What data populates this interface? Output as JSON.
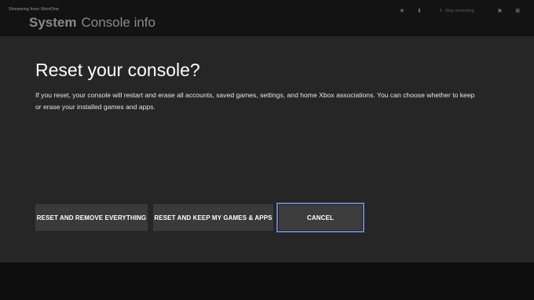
{
  "stream": {
    "label": "Streaming from XboxOne"
  },
  "header": {
    "section": "System",
    "page": "Console info"
  },
  "status": {
    "icons": [
      "headset-icon",
      "mic-icon",
      "controller-icon",
      "battery-icon",
      "settings-icon"
    ],
    "stop_label": "Stop streaming"
  },
  "dialog": {
    "title": "Reset your console?",
    "body": "If you reset, your console will restart and erase all accounts, saved games, settings, and home Xbox associations. You can choose whether to keep or erase your installed games and apps.",
    "buttons": {
      "remove_everything": "RESET AND REMOVE EVERYTHING",
      "keep_games": "RESET AND KEEP MY GAMES & APPS",
      "cancel": "CANCEL"
    },
    "focused_button": "cancel",
    "focus_color": "#5b82d6"
  }
}
